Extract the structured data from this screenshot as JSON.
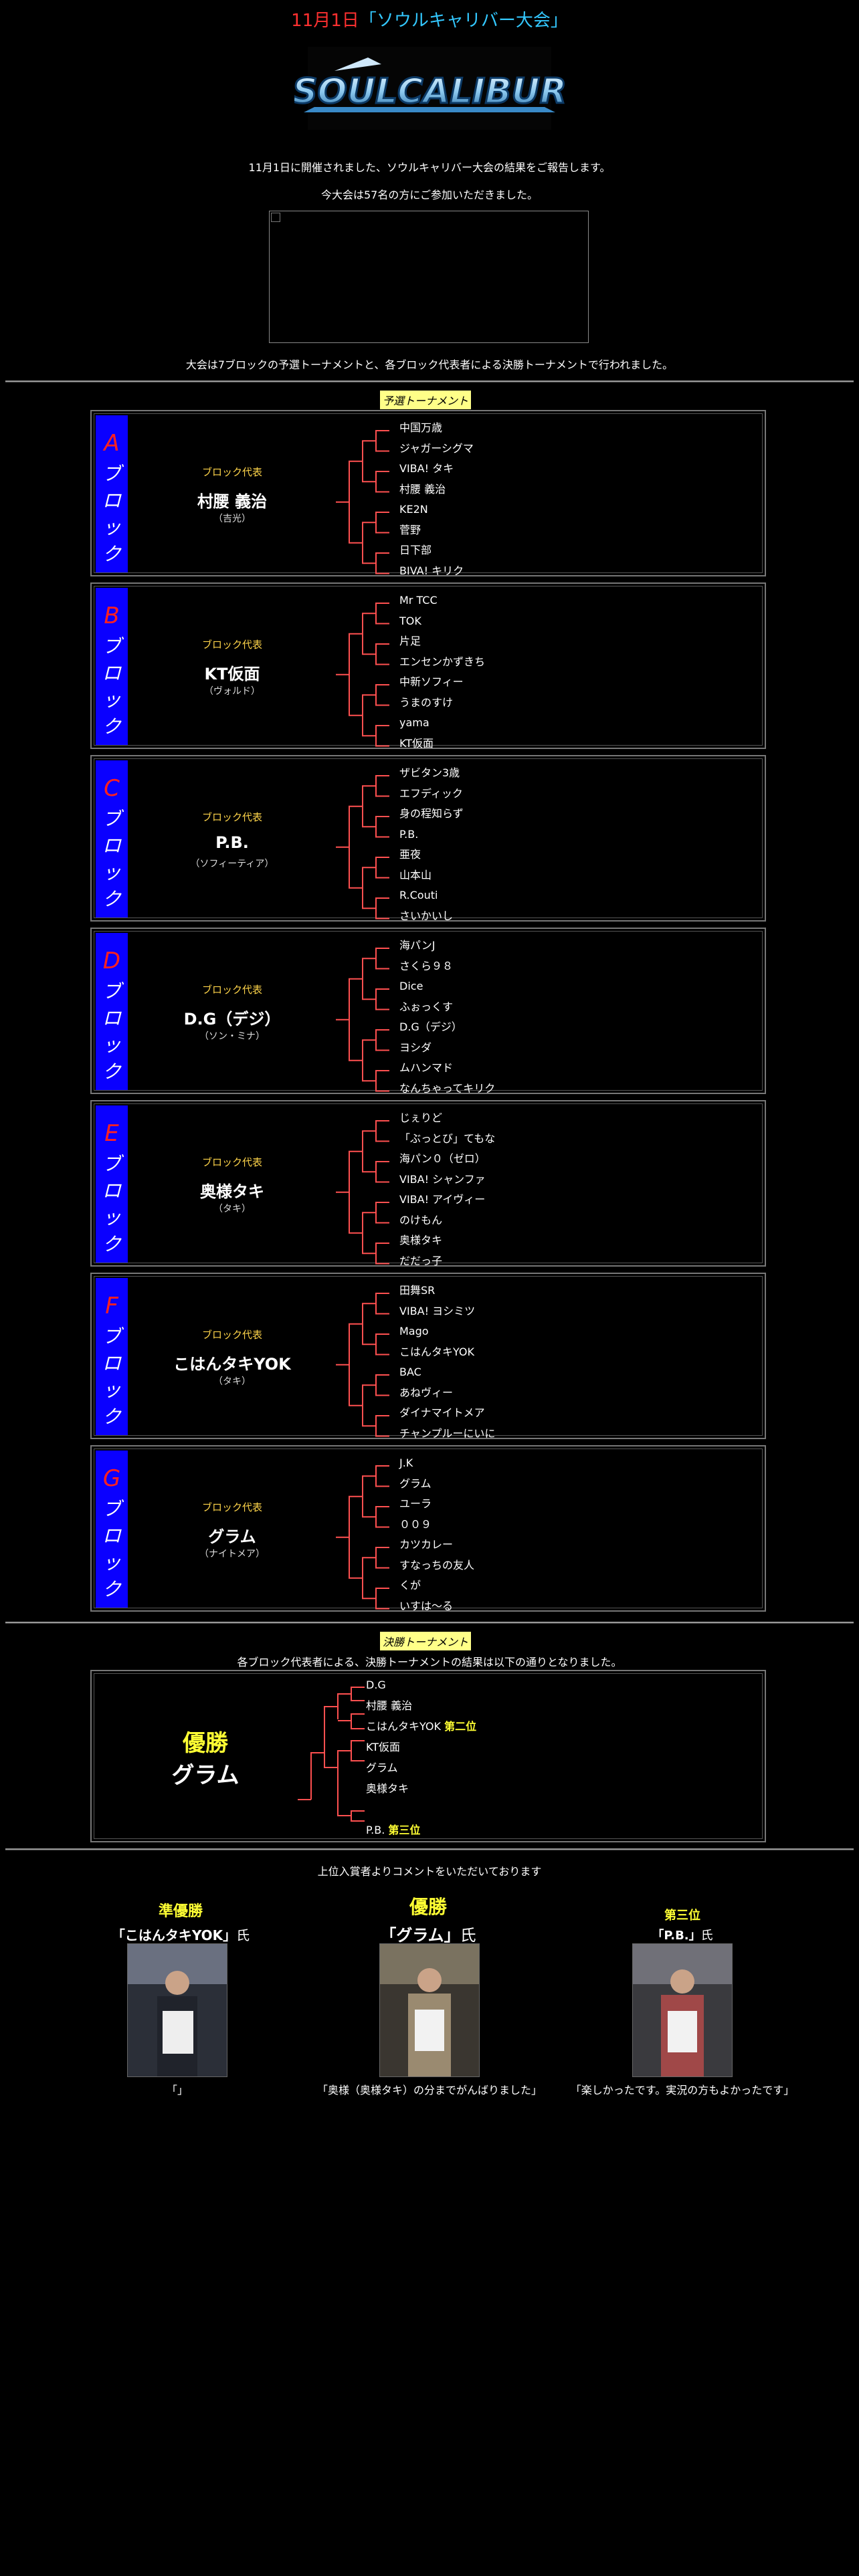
{
  "title": {
    "date": "11月1日",
    "name": "「ソウルキャリバー大会」"
  },
  "logo": {
    "text": "SOULCALIBUR"
  },
  "intro": {
    "line1": "11月1日に開催されました、ソウルキャリバー大会の結果をご報告します。",
    "line2": "今大会は57名の方にご参加いただきました。",
    "line3": "大会は7ブロックの予選トーナメントと、各ブロック代表者による決勝トーナメントで行われました。"
  },
  "qualifier": {
    "tag": "予選トーナメント"
  },
  "blocks": [
    {
      "letter": "A",
      "kana": [
        "ブ",
        "ロ",
        "ッ",
        "ク"
      ],
      "rep_label": "ブロック代表",
      "rep_name": "村腰 義治",
      "rep_char": "（吉光）",
      "players": [
        "中国万歳",
        "ジャガーシグマ",
        "VIBA! タキ",
        "村腰 義治",
        "KE2N",
        "菅野",
        "日下部",
        "BIVA! キリク"
      ]
    },
    {
      "letter": "B",
      "kana": [
        "ブ",
        "ロ",
        "ッ",
        "ク"
      ],
      "rep_label": "ブロック代表",
      "rep_name": "KT仮面",
      "rep_char": "（ヴォルド）",
      "players": [
        "Mr TCC",
        "TOK",
        "片足",
        "エンセンかずきち",
        "中新ソフィー",
        "うまのすけ",
        "yama",
        "KT仮面"
      ]
    },
    {
      "letter": "C",
      "kana": [
        "ブ",
        "ロ",
        "ッ",
        "ク"
      ],
      "rep_label": "ブロック代表",
      "rep_name": "P.B.",
      "rep_char": "（ソフィーティア）",
      "players": [
        "ザビタン3歳",
        "エフディック",
        "身の程知らず",
        "P.B.",
        "亜夜",
        "山本山",
        "R.Couti",
        "さいかいし"
      ]
    },
    {
      "letter": "D",
      "kana": [
        "ブ",
        "ロ",
        "ッ",
        "ク"
      ],
      "rep_label": "ブロック代表",
      "rep_name": "D.G（デジ）",
      "rep_char": "（ソン・ミナ）",
      "players": [
        "海パンJ",
        "さくら９８",
        "Dice",
        "ふぉっくす",
        "D.G（デジ）",
        "ヨシダ",
        "ムハンマド",
        "なんちゃってキリク"
      ]
    },
    {
      "letter": "E",
      "kana": [
        "ブ",
        "ロ",
        "ッ",
        "ク"
      ],
      "rep_label": "ブロック代表",
      "rep_name": "奥様タキ",
      "rep_char": "（タキ）",
      "players": [
        "じぇりど",
        "「ぶっとび」てもな",
        "海パン０（ゼロ）",
        "VIBA! シャンファ",
        "VIBA! アイヴィー",
        "のけもん",
        "奥様タキ",
        "だだっ子"
      ]
    },
    {
      "letter": "F",
      "kana": [
        "ブ",
        "ロ",
        "ッ",
        "ク"
      ],
      "rep_label": "ブロック代表",
      "rep_name": "こはんタキYOK",
      "rep_char": "（タキ）",
      "players": [
        "田舞SR",
        "VIBA! ヨシミツ",
        "Mago",
        "こはんタキYOK",
        "BAC",
        "あねヴィー",
        "ダイナマイトメア",
        "チャンプルーにいに"
      ]
    },
    {
      "letter": "G",
      "kana": [
        "ブ",
        "ロ",
        "ッ",
        "ク"
      ],
      "rep_label": "ブロック代表",
      "rep_name": "グラム",
      "rep_char": "（ナイトメア）",
      "players": [
        "J.K",
        "グラム",
        "ユーラ",
        "００９",
        "カツカレー",
        "すなっちの友人",
        "くが",
        "いすは〜る"
      ]
    }
  ],
  "final": {
    "tag": "決勝トーナメント",
    "desc": "各ブロック代表者による、決勝トーナメントの結果は以下の通りとなりました。",
    "winner_label": "優勝",
    "winner_name": "グラム",
    "players": [
      {
        "name": "D.G",
        "note": ""
      },
      {
        "name": "村腰 義治",
        "note": ""
      },
      {
        "name": "こはんタキYOK",
        "note": "第二位"
      },
      {
        "name": "KT仮面",
        "note": ""
      },
      {
        "name": "グラム",
        "note": ""
      },
      {
        "name": "奥様タキ",
        "note": ""
      },
      {
        "name": "",
        "note": ""
      },
      {
        "name": "P.B.",
        "note": "第三位"
      }
    ]
  },
  "comments": {
    "intro": "上位入賞者よりコメントをいただいております",
    "second": {
      "rank": "準優勝",
      "name": "「こはんタキYOK」",
      "suffix": "氏",
      "comment": "「」"
    },
    "first": {
      "rank": "優勝",
      "name": "「グラム」",
      "suffix": "氏",
      "comment": "「奥様（奥様タキ）の分までがんばりました」"
    },
    "third": {
      "rank": "第三位",
      "name": "「P.B.」",
      "suffix": "氏",
      "comment": "「楽しかったです。実況の方もよかったです」"
    }
  },
  "colors": {
    "accent_red": "#ff3030",
    "accent_cyan": "#33c8ff",
    "block_blue": "#0a00ff",
    "bracket_red": "#ff5050",
    "highlight_yellow": "#ffff33"
  }
}
